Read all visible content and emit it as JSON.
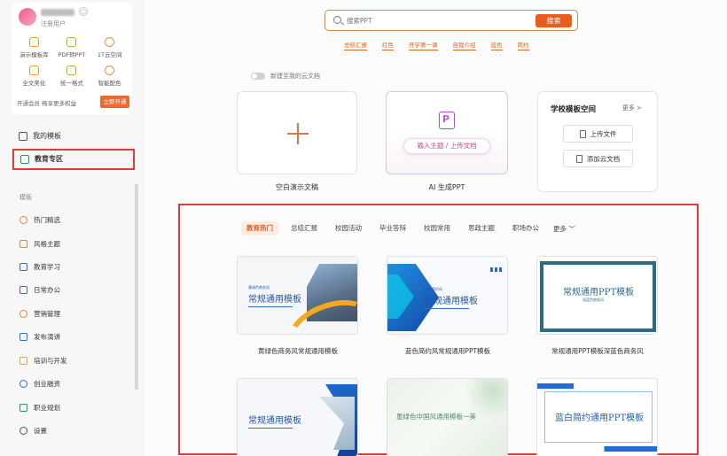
{
  "sidebar": {
    "user": {
      "role": "注册用户"
    },
    "features_row1": [
      "演示模板库",
      "PDF转PPT",
      "1T云空间"
    ],
    "features_row2": [
      "全文美化",
      "统一格式",
      "智能配色"
    ],
    "vip_note": "开通会员 畅享更多权益",
    "vip_button": "立即开通",
    "nav_my_templates": "我的模板",
    "nav_education": "教育专区",
    "section_label": "模板",
    "categories": [
      "热门精选",
      "风格主题",
      "教育学习",
      "日常办公",
      "营销管理",
      "发布演讲",
      "培训与开发",
      "创业融资",
      "职业规划",
      "设置"
    ]
  },
  "search": {
    "placeholder": "搜索PPT",
    "button": "搜索"
  },
  "hot_words": [
    "总结汇报",
    "红色",
    "开学第一课",
    "自我介绍",
    "蓝色",
    "简约"
  ],
  "cloud_toggle_label": "新建至我的云文档",
  "blank_card_label": "空白演示文稿",
  "ai_card": {
    "input_button": "输入主题 / 上传文档",
    "label": "AI 生成PPT"
  },
  "school_card": {
    "title": "学校模板空间",
    "more": "更多 >",
    "upload_button": "上传文件",
    "add_cloud_button": "添加云文档"
  },
  "tabs": [
    "教育热门",
    "总结汇报",
    "校园活动",
    "毕业答辩",
    "校园常用",
    "思政主题",
    "职场办公"
  ],
  "tabs_more": "更多 ﹀",
  "templates": [
    {
      "name": "黄绿色商务风常规通用模板",
      "title": "常规通用模板",
      "tag": "黄绿色商务风"
    },
    {
      "name": "蓝色简约风常规通用PPT模板",
      "title": "常规通用模板",
      "tag": "蓝色简约风"
    },
    {
      "name": "常规通用PPT模板深蓝色商务风",
      "title": "常规通用PPT模板",
      "tag": "深蓝色商务风"
    },
    {
      "name": "",
      "title": "常规通用模板",
      "tag": ""
    },
    {
      "name": "",
      "title": "墨绿色中国风通用模板一美",
      "tag": ""
    },
    {
      "name": "",
      "title": "蓝白简约通用PPT模板",
      "tag": ""
    }
  ],
  "colors": {
    "accent": "#e85c1c",
    "highlight": "#e53935",
    "template_blue": "#2458a6"
  }
}
